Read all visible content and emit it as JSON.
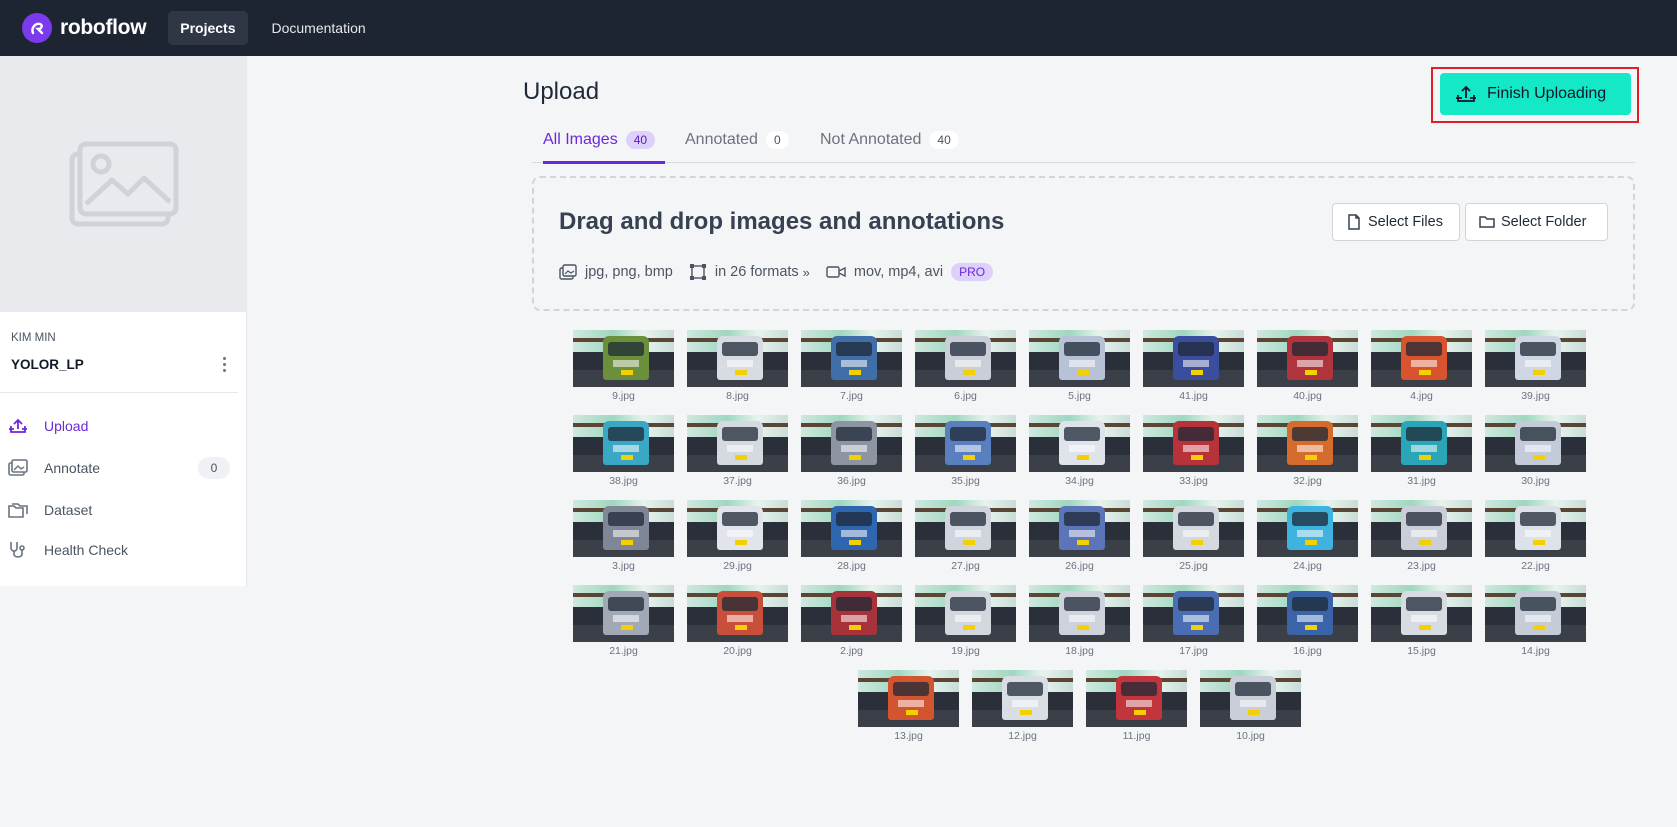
{
  "topbar": {
    "logo_text": "roboflow",
    "nav": [
      "Projects",
      "Documentation"
    ]
  },
  "sidebar": {
    "owner": "KIM MIN",
    "project_name": "YOLOR_LP",
    "items": [
      {
        "label": "Upload",
        "icon": "upload-icon",
        "active": true
      },
      {
        "label": "Annotate",
        "icon": "annotate-icon",
        "count": "0"
      },
      {
        "label": "Dataset",
        "icon": "folders-icon"
      },
      {
        "label": "Health Check",
        "icon": "stethoscope-icon"
      }
    ]
  },
  "main": {
    "title": "Upload",
    "finish_label": "Finish Uploading",
    "tabs": [
      {
        "label": "All Images",
        "count": "40",
        "active": true
      },
      {
        "label": "Annotated",
        "count": "0"
      },
      {
        "label": "Not Annotated",
        "count": "40"
      }
    ],
    "dropzone": {
      "title": "Drag and drop images and annotations",
      "select_files": "Select Files",
      "select_folder": "Select Folder",
      "image_formats": "jpg, png, bmp",
      "annotation_formats_prefix": "in",
      "annotation_formats_count": "26 formats",
      "video_formats": "mov, mp4, avi",
      "pro_badge": "PRO"
    },
    "images": [
      {
        "name": "9.jpg",
        "color": "#6b8f3a"
      },
      {
        "name": "8.jpg",
        "color": "#d7dbe2"
      },
      {
        "name": "7.jpg",
        "color": "#3f6ea8"
      },
      {
        "name": "6.jpg",
        "color": "#c9ced8"
      },
      {
        "name": "5.jpg",
        "color": "#b8c2d6"
      },
      {
        "name": "41.jpg",
        "color": "#3b4e9e"
      },
      {
        "name": "40.jpg",
        "color": "#b0343c"
      },
      {
        "name": "4.jpg",
        "color": "#d9532e"
      },
      {
        "name": "39.jpg",
        "color": "#cfd6e4"
      },
      {
        "name": "38.jpg",
        "color": "#3aa7c4"
      },
      {
        "name": "37.jpg",
        "color": "#d5d9e0"
      },
      {
        "name": "36.jpg",
        "color": "#8d95a3"
      },
      {
        "name": "35.jpg",
        "color": "#5a7fbf"
      },
      {
        "name": "34.jpg",
        "color": "#dfe3ea"
      },
      {
        "name": "33.jpg",
        "color": "#b8323a"
      },
      {
        "name": "32.jpg",
        "color": "#d66b2e"
      },
      {
        "name": "31.jpg",
        "color": "#2aa6b8"
      },
      {
        "name": "30.jpg",
        "color": "#c4cbd8"
      },
      {
        "name": "3.jpg",
        "color": "#7f8796"
      },
      {
        "name": "29.jpg",
        "color": "#e1e4ea"
      },
      {
        "name": "28.jpg",
        "color": "#2f66b0"
      },
      {
        "name": "27.jpg",
        "color": "#cfd4dd"
      },
      {
        "name": "26.jpg",
        "color": "#5c74b8"
      },
      {
        "name": "25.jpg",
        "color": "#d4d8df"
      },
      {
        "name": "24.jpg",
        "color": "#3fb3e0"
      },
      {
        "name": "23.jpg",
        "color": "#c9ced8"
      },
      {
        "name": "22.jpg",
        "color": "#dde1e8"
      },
      {
        "name": "21.jpg",
        "color": "#a2a9b6"
      },
      {
        "name": "20.jpg",
        "color": "#c8503a"
      },
      {
        "name": "2.jpg",
        "color": "#a8323a"
      },
      {
        "name": "19.jpg",
        "color": "#d3d7de"
      },
      {
        "name": "18.jpg",
        "color": "#cdd2db"
      },
      {
        "name": "17.jpg",
        "color": "#4b6db4"
      },
      {
        "name": "16.jpg",
        "color": "#3a63a8"
      },
      {
        "name": "15.jpg",
        "color": "#d7dbe2"
      },
      {
        "name": "14.jpg",
        "color": "#c6ccd7"
      },
      {
        "name": "13.jpg",
        "color": "#d2552f"
      },
      {
        "name": "12.jpg",
        "color": "#d9dde4"
      },
      {
        "name": "11.jpg",
        "color": "#c3353c"
      },
      {
        "name": "10.jpg",
        "color": "#c9ced8"
      }
    ]
  },
  "colors": {
    "topbar": "#1e2532",
    "accent": "#6d28d9",
    "finish_button": "#14e8c6",
    "highlight_outline": "#e11d2a"
  }
}
